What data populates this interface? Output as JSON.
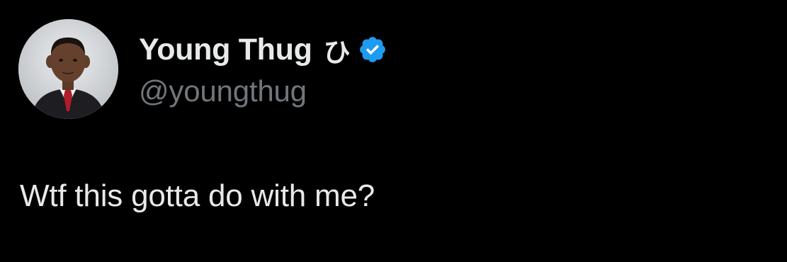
{
  "tweet": {
    "author": {
      "display_name": "Young Thug",
      "name_emoji": "ひ",
      "handle": "@youngthug",
      "verified_color": "#1d9bf0"
    },
    "text": "Wtf this gotta do with me?"
  },
  "theme": {
    "background": "#000000",
    "primary_text": "#e7e9ea",
    "secondary_text": "#71767b"
  }
}
